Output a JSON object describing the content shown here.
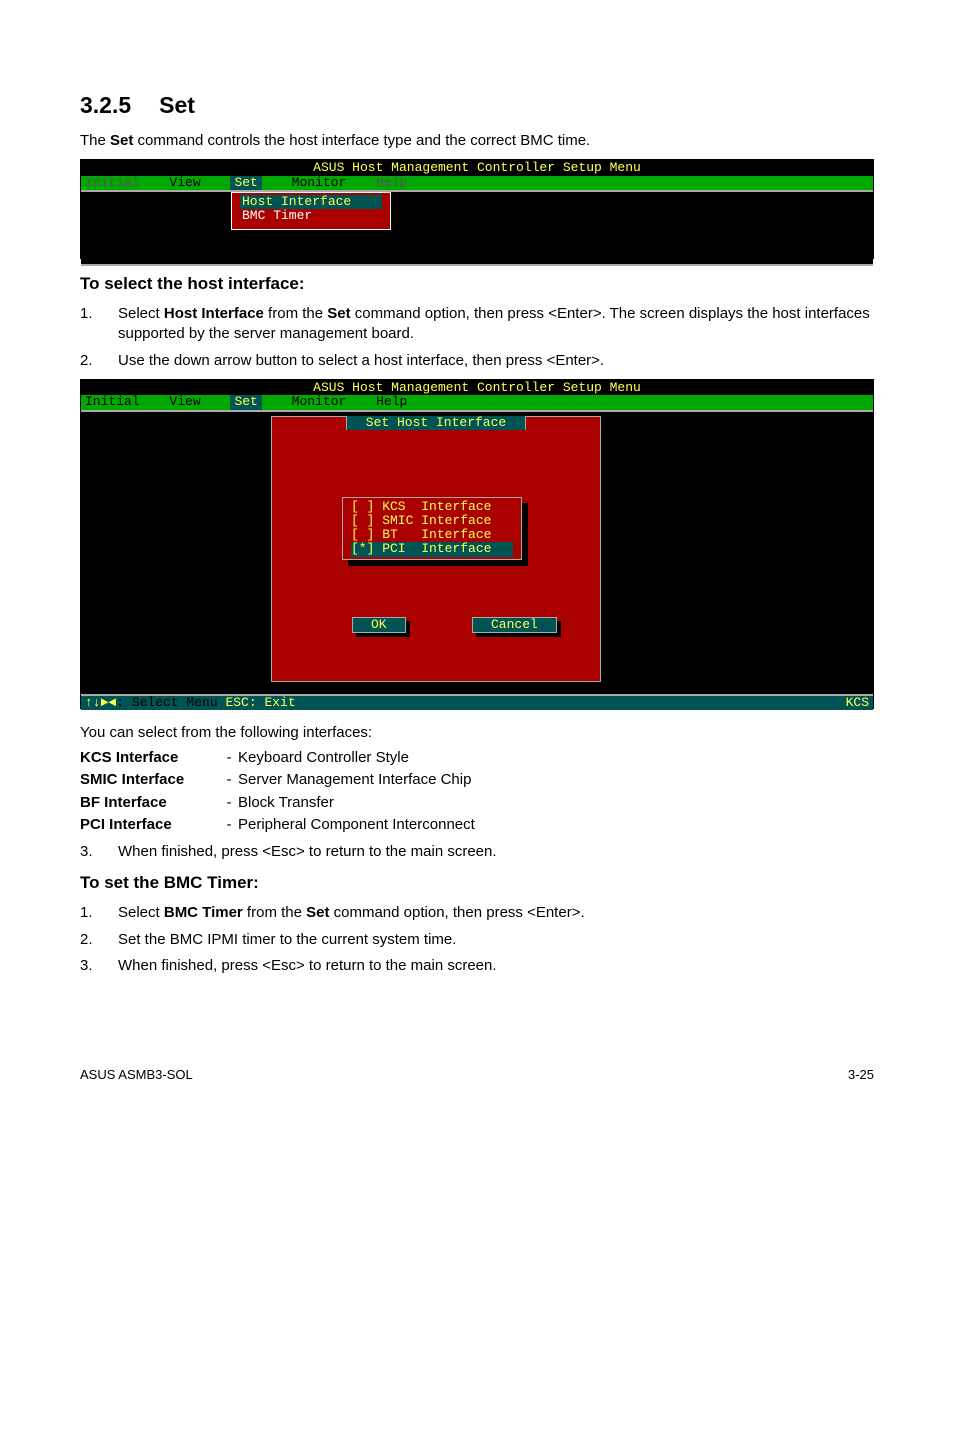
{
  "section": {
    "number": "3.2.5",
    "title": "Set"
  },
  "lead_pre": "The ",
  "lead_bold": "Set",
  "lead_post": " command controls the host interface type and the correct BMC time.",
  "dos_common": {
    "title": "ASUS Host Management Controller Setup Menu",
    "menu": {
      "initial": "Initial",
      "view": "View",
      "set": "Set",
      "monitor": "Monitor",
      "help": "Help"
    }
  },
  "dos1": {
    "dropdown": {
      "item_hi": "Host Interface",
      "item_bmc": "BMC Timer"
    }
  },
  "sub1": "To select the host interface:",
  "steps1": [
    {
      "n": "1.",
      "pre": "Select ",
      "b1": "Host Interface",
      "mid": " from the ",
      "b2": "Set",
      "post": " command option, then press <Enter>. The screen displays the host interfaces supported by the server management board."
    },
    {
      "n": "2.",
      "plain": "Use the down arrow button to select a host interface, then press <Enter>."
    }
  ],
  "dos2": {
    "dialog_title": "Set Host Interface",
    "options": [
      "[ ] KCS  Interface",
      "[ ] SMIC Interface",
      "[ ] BT   Interface",
      "[*] PCI  Interface"
    ],
    "ok": "OK",
    "cancel": "Cancel",
    "status_left_arrows": "↑↓►◄",
    "status_left_select": ": Select Menu",
    "status_left_esc": "  ESC: Exit",
    "status_right": "KCS"
  },
  "intro_list": "You can select from the following interfaces:",
  "defs": [
    {
      "k": "KCS Interface",
      "v": "Keyboard Controller Style"
    },
    {
      "k": "SMIC Interface",
      "v": "Server Management Interface Chip"
    },
    {
      "k": "BF Interface",
      "v": "Block Transfer"
    },
    {
      "k": "PCI Interface",
      "v": "Peripheral Component Interconnect"
    }
  ],
  "step3a": {
    "n": "3.",
    "t": "When finished, press <Esc> to return to the main screen."
  },
  "sub2": "To set the BMC Timer:",
  "steps2": [
    {
      "n": "1.",
      "pre": "Select ",
      "b1": "BMC Timer",
      "mid": " from the ",
      "b2": "Set",
      "post": " command option, then press <Enter>."
    },
    {
      "n": "2.",
      "plain": "Set the BMC IPMI timer to the current system time."
    },
    {
      "n": "3.",
      "plain": "When finished, press <Esc> to return to the main screen."
    }
  ],
  "footer": {
    "left": "ASUS ASMB3-SOL",
    "right": "3-25"
  }
}
